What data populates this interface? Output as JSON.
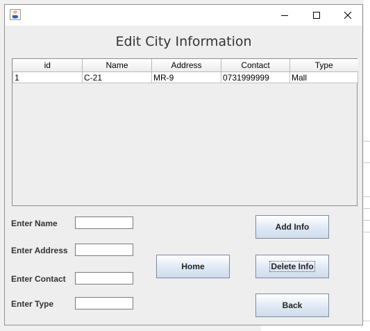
{
  "window": {
    "title_icon": "java-cup-icon",
    "controls": [
      "minimize-icon",
      "maximize-icon",
      "close-icon"
    ]
  },
  "heading": "Edit City Information",
  "table": {
    "columns": [
      "id",
      "Name",
      "Address",
      "Contact",
      "Type"
    ],
    "rows": [
      [
        "1",
        "C-21",
        "MR-9",
        "0731999999",
        "Mall"
      ]
    ]
  },
  "form": {
    "name_label": "Enter Name",
    "address_label": "Enter Address",
    "contact_label": "Enter Contact",
    "type_label": "Enter Type",
    "name_value": "",
    "address_value": "",
    "contact_value": "",
    "type_value": ""
  },
  "buttons": {
    "add": "Add Info",
    "home": "Home",
    "delete": "Delete Info",
    "back": "Back"
  },
  "colors": {
    "title_bar": "#ffffff",
    "window_bg": "#eeeeee",
    "button_gradient_end": "#cfdceb"
  }
}
